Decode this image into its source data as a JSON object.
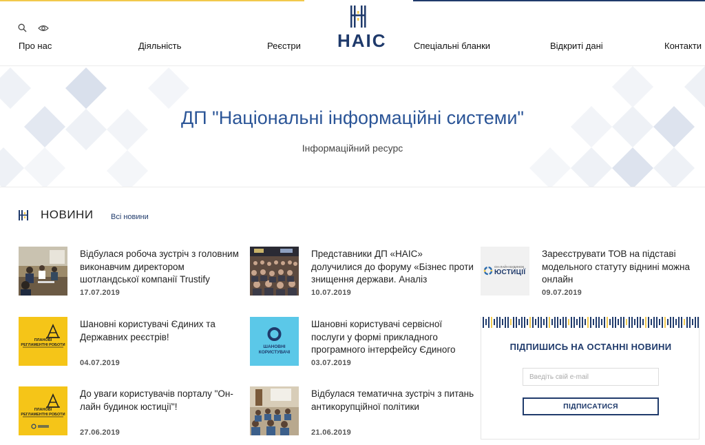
{
  "header": {
    "logo_text": "НАІС",
    "nav": [
      "Про нас",
      "Діяльність",
      "Реєстри",
      "Спеціальні бланки",
      "Відкриті дані",
      "Контакти"
    ],
    "icons": [
      "search-icon",
      "eye-icon"
    ],
    "colors": {
      "brand_blue": "#1f3a6b",
      "accent_yellow": "#f2c94c"
    }
  },
  "hero": {
    "title": "ДП \"Національні інформаційні системи\"",
    "subtitle": "Інформаційний ресурс"
  },
  "news": {
    "section_title": "НОВИНИ",
    "all_link": "Всі новини",
    "items": [
      {
        "title": "Відбулася робоча зустріч з головним виконавчим директором шотландської компанії Trustify",
        "date": "17.07.2019"
      },
      {
        "title": "Представники ДП «НАІС» долучилися до форуму «Бізнес проти знищення держави. Аналіз",
        "date": "10.07.2019"
      },
      {
        "title": "Зареєструвати ТОВ на підставі модельного статуту віднині можна онлайн",
        "date": "09.07.2019",
        "thumb_text_small": "ОН-ЛАЙН БУДИНОК",
        "thumb_text_big": "ЮСТИЦІЇ"
      },
      {
        "title": "Шановні користувачі Єдиних та Державних реєстрів!",
        "date": "04.07.2019",
        "thumb_text_a": "ПЛАНОВІ",
        "thumb_text_b": "РЕГЛАМЕНТНІ РОБОТИ"
      },
      {
        "title": "Шановні користувачі сервісної послуги у формі прикладного програмного інтерфейсу Єдиного",
        "date": "03.07.2019",
        "thumb_text_a": "ШАНОВНІ",
        "thumb_text_b": "КОРИСТУВАЧІ"
      },
      {
        "title": "До уваги користувачів порталу \"Он-лайн будинок юстиції\"!",
        "date": "27.06.2019",
        "thumb_text_a": "ПЛАНОВІ",
        "thumb_text_b": "РЕГЛАМЕНТНІ РОБОТИ"
      },
      {
        "title": "Відбулася тематична зустріч з питань антикорупційної політики",
        "date": "21.06.2019"
      }
    ]
  },
  "subscribe": {
    "title": "ПІДПИШИСЬ НА ОСТАННІ НОВИНИ",
    "placeholder": "Введіть свій e-mail",
    "value": "",
    "button": "ПІДПИСАТИСЯ"
  }
}
